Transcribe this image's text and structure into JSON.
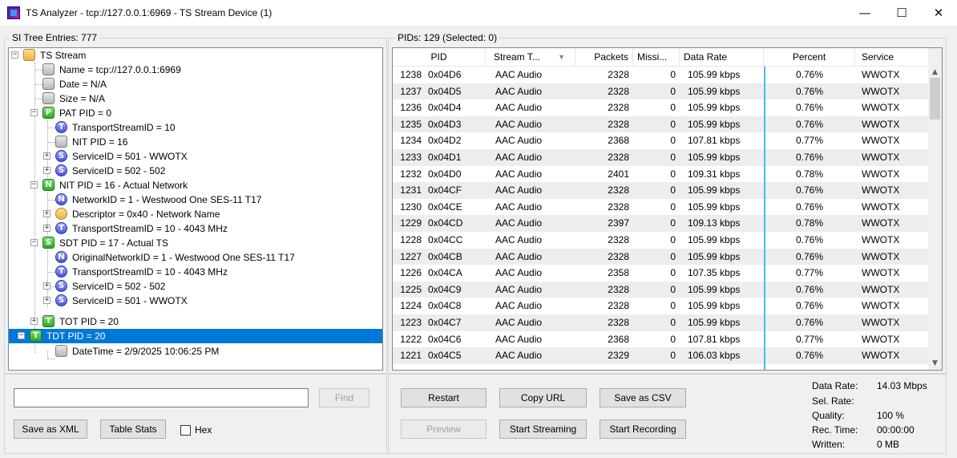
{
  "window": {
    "title": "TS Analyzer - tcp://127.0.0.1:6969 - TS Stream Device (1)",
    "minimize": "—",
    "maximize": "☐",
    "close": "✕"
  },
  "si_tree": {
    "label": "SI Tree Entries: 777",
    "nodes": [
      {
        "text": "TS Stream"
      },
      {
        "text": "Name = tcp://127.0.0.1:6969"
      },
      {
        "text": "Date = N/A"
      },
      {
        "text": "Size = N/A"
      },
      {
        "text": "PAT PID = 0",
        "badge": "P"
      },
      {
        "text": "TransportStreamID = 10",
        "badge": "T"
      },
      {
        "text": "NIT PID = 16"
      },
      {
        "text": "ServiceID = 501 - WWOTX",
        "badge": "S"
      },
      {
        "text": "ServiceID = 502 - 502",
        "badge": "S"
      },
      {
        "text": "NIT PID = 16 - Actual Network",
        "badge": "N"
      },
      {
        "text": "NetworkID = 1 - Westwood One SES-11 T17",
        "badge": "N"
      },
      {
        "text": "Descriptor = 0x40 - Network Name"
      },
      {
        "text": "TransportStreamID = 10 - 4043 MHz",
        "badge": "T"
      },
      {
        "text": "SDT PID = 17 - Actual TS",
        "badge": "S"
      },
      {
        "text": "OriginalNetworkID = 1 - Westwood One SES-11 T17",
        "badge": "N"
      },
      {
        "text": "TransportStreamID = 10 - 4043 MHz",
        "badge": "T"
      },
      {
        "text": "ServiceID = 502 - 502",
        "badge": "S"
      },
      {
        "text": "ServiceID = 501 - WWOTX",
        "badge": "S"
      },
      {
        "text": "TOT PID = 20",
        "badge": "T"
      },
      {
        "text": "TDT PID = 20",
        "badge": "T"
      },
      {
        "text": "DateTime = 2/9/2025 10:06:25 PM"
      }
    ],
    "expander_plus": "+",
    "expander_minus": "−"
  },
  "search": {
    "value": "",
    "find_label": "Find"
  },
  "buttons_left": {
    "save_xml": "Save as XML",
    "table_stats": "Table Stats",
    "hex_label": "Hex"
  },
  "pids": {
    "label": "PIDs: 129   (Selected: 0)",
    "columns": [
      "PID",
      "Stream T...",
      "Packets",
      "Missi...",
      "Data Rate",
      "Percent",
      "Service"
    ],
    "sort_icon": "▼",
    "rows": [
      [
        "1238",
        "0x04D6",
        "AAC Audio",
        "2328",
        "0",
        "105.99 kbps",
        "0.76%",
        "WWOTX"
      ],
      [
        "1237",
        "0x04D5",
        "AAC Audio",
        "2328",
        "0",
        "105.99 kbps",
        "0.76%",
        "WWOTX"
      ],
      [
        "1236",
        "0x04D4",
        "AAC Audio",
        "2328",
        "0",
        "105.99 kbps",
        "0.76%",
        "WWOTX"
      ],
      [
        "1235",
        "0x04D3",
        "AAC Audio",
        "2328",
        "0",
        "105.99 kbps",
        "0.76%",
        "WWOTX"
      ],
      [
        "1234",
        "0x04D2",
        "AAC Audio",
        "2368",
        "0",
        "107.81 kbps",
        "0.77%",
        "WWOTX"
      ],
      [
        "1233",
        "0x04D1",
        "AAC Audio",
        "2328",
        "0",
        "105.99 kbps",
        "0.76%",
        "WWOTX"
      ],
      [
        "1232",
        "0x04D0",
        "AAC Audio",
        "2401",
        "0",
        "109.31 kbps",
        "0.78%",
        "WWOTX"
      ],
      [
        "1231",
        "0x04CF",
        "AAC Audio",
        "2328",
        "0",
        "105.99 kbps",
        "0.76%",
        "WWOTX"
      ],
      [
        "1230",
        "0x04CE",
        "AAC Audio",
        "2328",
        "0",
        "105.99 kbps",
        "0.76%",
        "WWOTX"
      ],
      [
        "1229",
        "0x04CD",
        "AAC Audio",
        "2397",
        "0",
        "109.13 kbps",
        "0.78%",
        "WWOTX"
      ],
      [
        "1228",
        "0x04CC",
        "AAC Audio",
        "2328",
        "0",
        "105.99 kbps",
        "0.76%",
        "WWOTX"
      ],
      [
        "1227",
        "0x04CB",
        "AAC Audio",
        "2328",
        "0",
        "105.99 kbps",
        "0.76%",
        "WWOTX"
      ],
      [
        "1226",
        "0x04CA",
        "AAC Audio",
        "2358",
        "0",
        "107.35 kbps",
        "0.77%",
        "WWOTX"
      ],
      [
        "1225",
        "0x04C9",
        "AAC Audio",
        "2328",
        "0",
        "105.99 kbps",
        "0.76%",
        "WWOTX"
      ],
      [
        "1224",
        "0x04C8",
        "AAC Audio",
        "2328",
        "0",
        "105.99 kbps",
        "0.76%",
        "WWOTX"
      ],
      [
        "1223",
        "0x04C7",
        "AAC Audio",
        "2328",
        "0",
        "105.99 kbps",
        "0.76%",
        "WWOTX"
      ],
      [
        "1222",
        "0x04C6",
        "AAC Audio",
        "2368",
        "0",
        "107.81 kbps",
        "0.77%",
        "WWOTX"
      ],
      [
        "1221",
        "0x04C5",
        "AAC Audio",
        "2329",
        "0",
        "106.03 kbps",
        "0.76%",
        "WWOTX"
      ]
    ],
    "scroll_up": "▲",
    "scroll_down": "▼"
  },
  "buttons_right": {
    "restart": "Restart",
    "copy_url": "Copy URL",
    "save_csv": "Save as CSV",
    "preview": "Preview",
    "start_streaming": "Start Streaming",
    "start_recording": "Start Recording"
  },
  "stats": {
    "data_rate_label": "Data Rate:",
    "data_rate_value": "14.03 Mbps",
    "sel_rate_label": "Sel. Rate:",
    "sel_rate_value": "",
    "quality_label": "Quality:",
    "quality_value": "100 %",
    "rec_time_label": "Rec. Time:",
    "rec_time_value": "00:00:00",
    "written_label": "Written:",
    "written_value": "0 MB"
  },
  "colors": {
    "selection": "#0078d7",
    "rate_bar": "#35c6e8"
  }
}
